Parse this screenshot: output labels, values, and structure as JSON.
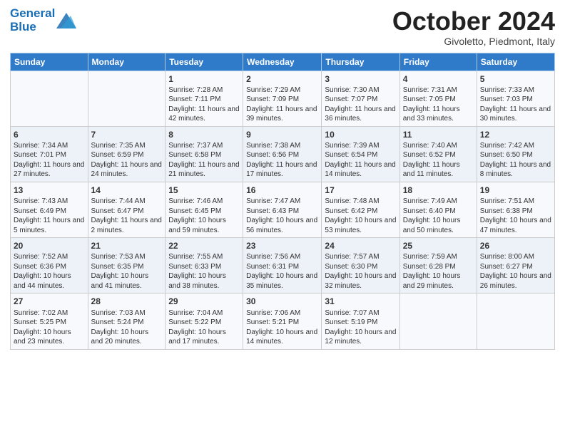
{
  "header": {
    "logo_line1": "General",
    "logo_line2": "Blue",
    "month": "October 2024",
    "location": "Givoletto, Piedmont, Italy"
  },
  "days_of_week": [
    "Sunday",
    "Monday",
    "Tuesday",
    "Wednesday",
    "Thursday",
    "Friday",
    "Saturday"
  ],
  "weeks": [
    [
      {
        "day": "",
        "sunrise": "",
        "sunset": "",
        "daylight": ""
      },
      {
        "day": "",
        "sunrise": "",
        "sunset": "",
        "daylight": ""
      },
      {
        "day": "1",
        "sunrise": "Sunrise: 7:28 AM",
        "sunset": "Sunset: 7:11 PM",
        "daylight": "Daylight: 11 hours and 42 minutes."
      },
      {
        "day": "2",
        "sunrise": "Sunrise: 7:29 AM",
        "sunset": "Sunset: 7:09 PM",
        "daylight": "Daylight: 11 hours and 39 minutes."
      },
      {
        "day": "3",
        "sunrise": "Sunrise: 7:30 AM",
        "sunset": "Sunset: 7:07 PM",
        "daylight": "Daylight: 11 hours and 36 minutes."
      },
      {
        "day": "4",
        "sunrise": "Sunrise: 7:31 AM",
        "sunset": "Sunset: 7:05 PM",
        "daylight": "Daylight: 11 hours and 33 minutes."
      },
      {
        "day": "5",
        "sunrise": "Sunrise: 7:33 AM",
        "sunset": "Sunset: 7:03 PM",
        "daylight": "Daylight: 11 hours and 30 minutes."
      }
    ],
    [
      {
        "day": "6",
        "sunrise": "Sunrise: 7:34 AM",
        "sunset": "Sunset: 7:01 PM",
        "daylight": "Daylight: 11 hours and 27 minutes."
      },
      {
        "day": "7",
        "sunrise": "Sunrise: 7:35 AM",
        "sunset": "Sunset: 6:59 PM",
        "daylight": "Daylight: 11 hours and 24 minutes."
      },
      {
        "day": "8",
        "sunrise": "Sunrise: 7:37 AM",
        "sunset": "Sunset: 6:58 PM",
        "daylight": "Daylight: 11 hours and 21 minutes."
      },
      {
        "day": "9",
        "sunrise": "Sunrise: 7:38 AM",
        "sunset": "Sunset: 6:56 PM",
        "daylight": "Daylight: 11 hours and 17 minutes."
      },
      {
        "day": "10",
        "sunrise": "Sunrise: 7:39 AM",
        "sunset": "Sunset: 6:54 PM",
        "daylight": "Daylight: 11 hours and 14 minutes."
      },
      {
        "day": "11",
        "sunrise": "Sunrise: 7:40 AM",
        "sunset": "Sunset: 6:52 PM",
        "daylight": "Daylight: 11 hours and 11 minutes."
      },
      {
        "day": "12",
        "sunrise": "Sunrise: 7:42 AM",
        "sunset": "Sunset: 6:50 PM",
        "daylight": "Daylight: 11 hours and 8 minutes."
      }
    ],
    [
      {
        "day": "13",
        "sunrise": "Sunrise: 7:43 AM",
        "sunset": "Sunset: 6:49 PM",
        "daylight": "Daylight: 11 hours and 5 minutes."
      },
      {
        "day": "14",
        "sunrise": "Sunrise: 7:44 AM",
        "sunset": "Sunset: 6:47 PM",
        "daylight": "Daylight: 11 hours and 2 minutes."
      },
      {
        "day": "15",
        "sunrise": "Sunrise: 7:46 AM",
        "sunset": "Sunset: 6:45 PM",
        "daylight": "Daylight: 10 hours and 59 minutes."
      },
      {
        "day": "16",
        "sunrise": "Sunrise: 7:47 AM",
        "sunset": "Sunset: 6:43 PM",
        "daylight": "Daylight: 10 hours and 56 minutes."
      },
      {
        "day": "17",
        "sunrise": "Sunrise: 7:48 AM",
        "sunset": "Sunset: 6:42 PM",
        "daylight": "Daylight: 10 hours and 53 minutes."
      },
      {
        "day": "18",
        "sunrise": "Sunrise: 7:49 AM",
        "sunset": "Sunset: 6:40 PM",
        "daylight": "Daylight: 10 hours and 50 minutes."
      },
      {
        "day": "19",
        "sunrise": "Sunrise: 7:51 AM",
        "sunset": "Sunset: 6:38 PM",
        "daylight": "Daylight: 10 hours and 47 minutes."
      }
    ],
    [
      {
        "day": "20",
        "sunrise": "Sunrise: 7:52 AM",
        "sunset": "Sunset: 6:36 PM",
        "daylight": "Daylight: 10 hours and 44 minutes."
      },
      {
        "day": "21",
        "sunrise": "Sunrise: 7:53 AM",
        "sunset": "Sunset: 6:35 PM",
        "daylight": "Daylight: 10 hours and 41 minutes."
      },
      {
        "day": "22",
        "sunrise": "Sunrise: 7:55 AM",
        "sunset": "Sunset: 6:33 PM",
        "daylight": "Daylight: 10 hours and 38 minutes."
      },
      {
        "day": "23",
        "sunrise": "Sunrise: 7:56 AM",
        "sunset": "Sunset: 6:31 PM",
        "daylight": "Daylight: 10 hours and 35 minutes."
      },
      {
        "day": "24",
        "sunrise": "Sunrise: 7:57 AM",
        "sunset": "Sunset: 6:30 PM",
        "daylight": "Daylight: 10 hours and 32 minutes."
      },
      {
        "day": "25",
        "sunrise": "Sunrise: 7:59 AM",
        "sunset": "Sunset: 6:28 PM",
        "daylight": "Daylight: 10 hours and 29 minutes."
      },
      {
        "day": "26",
        "sunrise": "Sunrise: 8:00 AM",
        "sunset": "Sunset: 6:27 PM",
        "daylight": "Daylight: 10 hours and 26 minutes."
      }
    ],
    [
      {
        "day": "27",
        "sunrise": "Sunrise: 7:02 AM",
        "sunset": "Sunset: 5:25 PM",
        "daylight": "Daylight: 10 hours and 23 minutes."
      },
      {
        "day": "28",
        "sunrise": "Sunrise: 7:03 AM",
        "sunset": "Sunset: 5:24 PM",
        "daylight": "Daylight: 10 hours and 20 minutes."
      },
      {
        "day": "29",
        "sunrise": "Sunrise: 7:04 AM",
        "sunset": "Sunset: 5:22 PM",
        "daylight": "Daylight: 10 hours and 17 minutes."
      },
      {
        "day": "30",
        "sunrise": "Sunrise: 7:06 AM",
        "sunset": "Sunset: 5:21 PM",
        "daylight": "Daylight: 10 hours and 14 minutes."
      },
      {
        "day": "31",
        "sunrise": "Sunrise: 7:07 AM",
        "sunset": "Sunset: 5:19 PM",
        "daylight": "Daylight: 10 hours and 12 minutes."
      },
      {
        "day": "",
        "sunrise": "",
        "sunset": "",
        "daylight": ""
      },
      {
        "day": "",
        "sunrise": "",
        "sunset": "",
        "daylight": ""
      }
    ]
  ]
}
